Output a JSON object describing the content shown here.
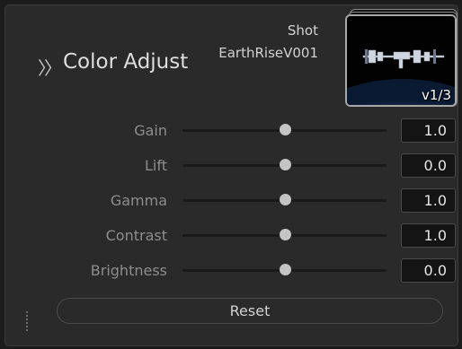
{
  "panel": {
    "title": "Color Adjust",
    "collapse_icon": "double-chevron-right-icon"
  },
  "shot": {
    "label": "Shot",
    "name": "EarthRiseV001",
    "version": "v1/3"
  },
  "sliders": [
    {
      "label": "Gain",
      "value": "1.0",
      "level": 0.5
    },
    {
      "label": "Lift",
      "value": "0.0",
      "level": 0.5
    },
    {
      "label": "Gamma",
      "value": "1.0",
      "level": 0.5
    },
    {
      "label": "Contrast",
      "value": "1.0",
      "level": 0.5
    },
    {
      "label": "Brightness",
      "value": "0.0",
      "level": 0.5
    }
  ],
  "reset": {
    "label": "Reset"
  },
  "colors": {
    "panel_bg": "#2a2a2a",
    "knob": "#c4c4c4",
    "label_text": "#8d8d8d"
  },
  "icons": {
    "grip": "resize-grip-icon"
  }
}
